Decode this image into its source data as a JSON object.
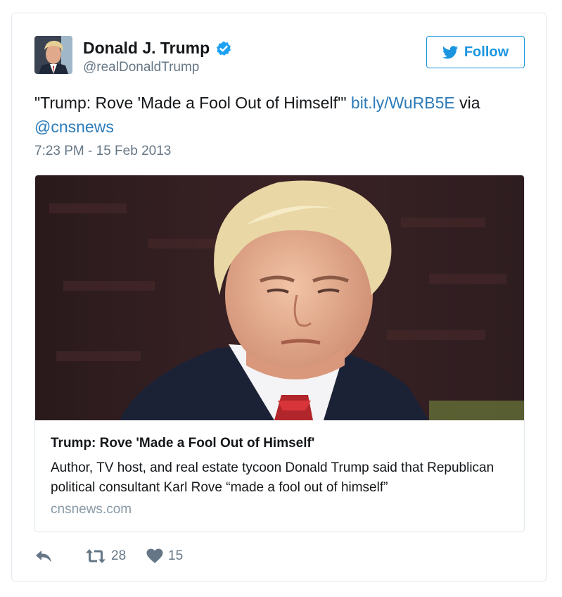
{
  "author": {
    "display_name": "Donald J. Trump",
    "handle": "@realDonaldTrump",
    "verified": true
  },
  "follow_button": {
    "label": "Follow"
  },
  "tweet": {
    "text_before": "\"Trump: Rove 'Made a Fool Out of Himself'\" ",
    "link": "bit.ly/WuRB5E",
    "text_middle": " via ",
    "mention": "@cnsnews",
    "timestamp": "7:23 PM - 15 Feb 2013"
  },
  "card": {
    "title": "Trump: Rove 'Made a Fool Out of Himself'",
    "description": "Author, TV host, and real estate tycoon Donald Trump said that Republican political consultant Karl Rove “made a fool out of himself”",
    "domain": "cnsnews.com"
  },
  "actions": {
    "retweets": "28",
    "likes": "15"
  },
  "colors": {
    "link": "#2b7bb9",
    "follow": "#1b95e0",
    "verified": "#1da1f2",
    "secondary_text": "#657786"
  },
  "icons": [
    "verified-badge-icon",
    "twitter-bird-icon",
    "reply-icon",
    "retweet-icon",
    "heart-icon"
  ]
}
